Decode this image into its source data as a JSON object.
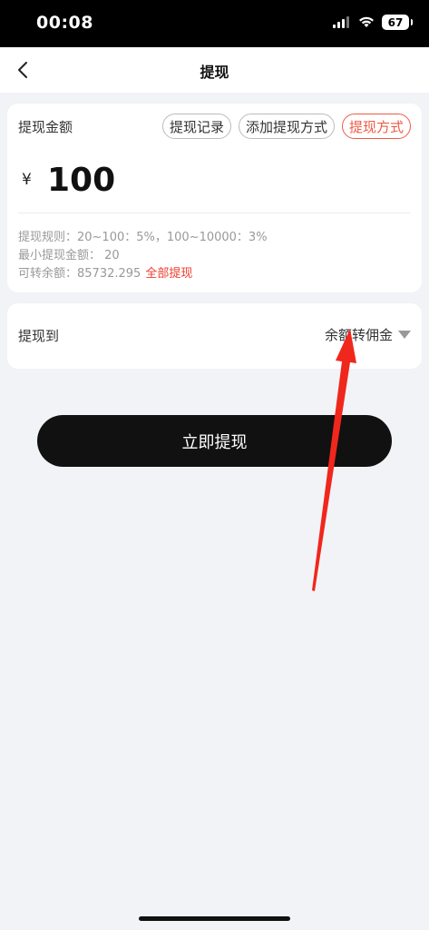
{
  "status_bar": {
    "time": "00:08",
    "battery": "67",
    "icons": [
      "signal-icon",
      "wifi-icon",
      "battery-icon"
    ]
  },
  "nav": {
    "title": "提现",
    "back_icon": "chevron-left-icon"
  },
  "amount_card": {
    "label": "提现金额",
    "chips": [
      {
        "label": "提现记录",
        "active": false
      },
      {
        "label": "添加提现方式",
        "active": false
      },
      {
        "label": "提现方式",
        "active": true
      }
    ],
    "currency": "¥",
    "amount": "100",
    "rules": {
      "fee_rule": "提现规则：20~100：5%，100~10000：3%",
      "min_amount": "最小提现金额： 20",
      "available_label": "可转余额：85732.295",
      "withdraw_all": "全部提现"
    }
  },
  "destination": {
    "label": "提现到",
    "selected": "余额转佣金",
    "dropdown_icon": "triangle-down-icon"
  },
  "submit": {
    "label": "立即提现"
  },
  "colors": {
    "accent": "#ee5a44",
    "link_red": "#ee3b2c",
    "button_bg": "#111111",
    "page_bg": "#f2f3f7",
    "annotation_arrow": "#f0271c"
  }
}
